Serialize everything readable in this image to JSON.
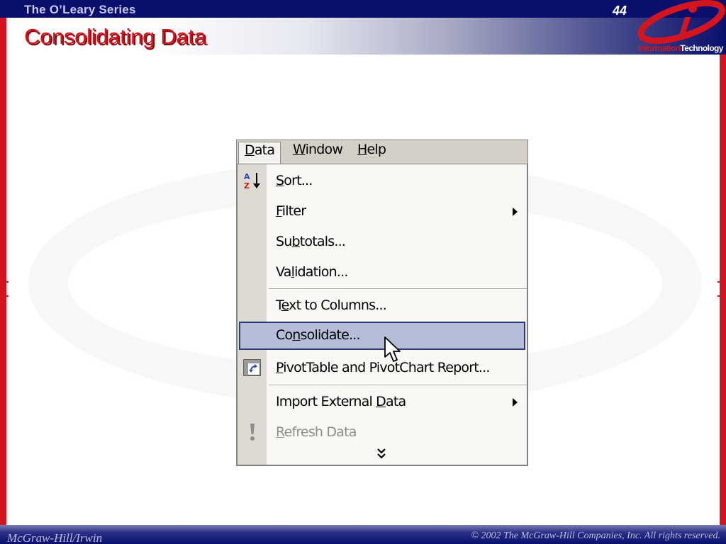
{
  "header": {
    "series": "The O’Leary Series",
    "page_number": "44",
    "title": "Consolidating Data",
    "logo_text_a": "Information",
    "logo_text_b": "Technology"
  },
  "footer": {
    "publisher": "McGraw-Hill/Irwin",
    "copyright": "© 2002  The McGraw-Hill Companies, Inc. All rights reserved."
  },
  "menubar": {
    "items": [
      {
        "pre": "",
        "u": "D",
        "post": "ata",
        "open": true
      },
      {
        "pre": "",
        "u": "W",
        "post": "indow",
        "open": false
      },
      {
        "pre": "",
        "u": "H",
        "post": "elp",
        "open": false
      }
    ]
  },
  "data_menu": {
    "items": [
      {
        "pre": "",
        "u": "S",
        "post": "ort...",
        "icon": "sort-az-icon"
      },
      {
        "pre": "",
        "u": "F",
        "post": "ilter",
        "submenu": true
      },
      {
        "pre": "Su",
        "u": "b",
        "post": "totals..."
      },
      {
        "pre": "Va",
        "u": "l",
        "post": "idation..."
      },
      {
        "pre": "T",
        "u": "e",
        "post": "xt to Columns..."
      },
      {
        "pre": "Co",
        "u": "n",
        "post": "solidate...",
        "highlighted": true
      },
      {
        "pre": "",
        "u": "P",
        "post": "ivotTable and PivotChart Report...",
        "icon": "pivottable-icon"
      },
      {
        "pre": "Import External ",
        "u": "D",
        "post": "ata",
        "submenu": true
      },
      {
        "pre": "",
        "u": "R",
        "post": "efresh Data",
        "disabled": true,
        "icon": "refresh-exclamation-icon"
      }
    ],
    "expand_icon": "chevron-double-down-icon"
  },
  "colors": {
    "brand_red": "#d2151f",
    "brand_navy": "#0a0f6b",
    "highlight": "#b6bdd8"
  }
}
